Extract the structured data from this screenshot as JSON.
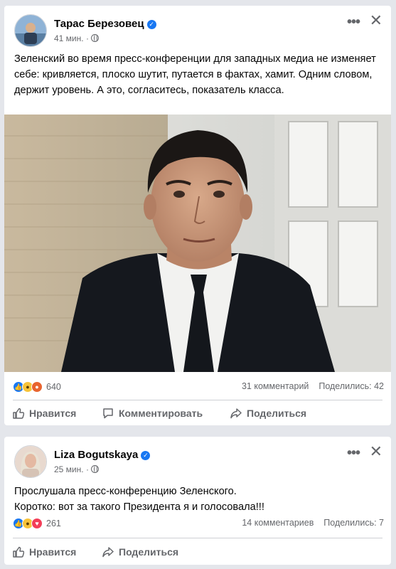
{
  "posts": [
    {
      "author": "Тарас Березовец",
      "time": "41 мин.",
      "text": "Зеленский во время пресс-конференции для западных медиа не изменяет себе: кривляется, плоско шутит, путается в фактах, хамит. Одним словом, держит уровень. А это, согласитесь, показатель класса.",
      "reactions_count": "640",
      "comments": "31 комментарий",
      "shares": "Поделились: 42",
      "actions": {
        "like": "Нравится",
        "comment": "Комментировать",
        "share": "Поделиться"
      }
    },
    {
      "author": "Liza Bogutskaya",
      "time": "25 мин.",
      "text_line1": "Прослушала пресс-конференцию Зеленского.",
      "text_line2": "Коротко: вот за такого Президента я и голосовала!!!",
      "reactions_count": "261",
      "comments": "14 комментариев",
      "shares": "Поделились: 7",
      "actions": {
        "like": "Нравится",
        "share": "Поделиться"
      }
    }
  ],
  "colors": {
    "background": "#e4e6eb",
    "card": "#ffffff",
    "secondary_text": "#65676b",
    "brand_blue": "#1877f2"
  },
  "icons": [
    "verified-badge-icon",
    "globe-icon",
    "more-options-icon",
    "close-icon",
    "like-icon",
    "comment-icon",
    "share-icon"
  ]
}
